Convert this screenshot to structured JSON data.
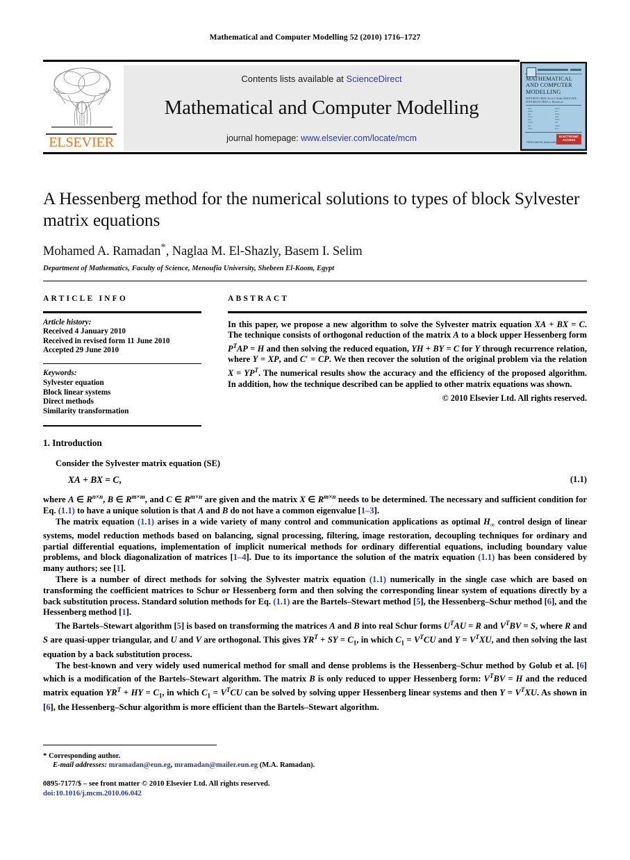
{
  "running_head": "Mathematical and Computer Modelling 52 (2010) 1716–1727",
  "masthead": {
    "contents_prefix": "Contents lists available at ",
    "sciencedirect": "ScienceDirect",
    "journal_name": "Mathematical and Computer Modelling",
    "homepage_prefix": "journal homepage: ",
    "homepage_url": "www.elsevier.com/locate/mcm",
    "publisher_wordmark": "ELSEVIER",
    "link_color": "#2B3B9E",
    "wordmark_color": "#E87722",
    "band_color": "#EAEAEA"
  },
  "cover": {
    "title": "MATHEMATICAL AND COMPUTER MODELLING",
    "editors": "EDITOR-IN-CHIEF: Ervin Y. Rodin\nASSOCIATE EDITORS-IN-CHIEF: C. Rhoades Jr.",
    "access_badge": "ELECTRONIC ACCESS",
    "publisher": "PERGAMON\nScienceDirect",
    "background_color": "#A8CCE4"
  },
  "article": {
    "title": "A Hessenberg method for the numerical solutions to types of block Sylvester matrix equations",
    "authors": "Mohamed A. Ramadan",
    "authors_rest": ", Naglaa M. El-Shazly, Basem I. Selim",
    "corresponding_marker": "*",
    "affiliation": "Department of Mathematics, Faculty of Science, Menoufia University, Shebeen El-Koom, Egypt"
  },
  "info": {
    "heading": "ARTICLE INFO",
    "history_label": "Article history:",
    "history": [
      "Received 4 January 2010",
      "Received in revised form 11 June 2010",
      "Accepted 29 June 2010"
    ],
    "keywords_label": "Keywords:",
    "keywords": [
      "Sylvester equation",
      "Block linear systems",
      "Direct methods",
      "Similarity transformation"
    ]
  },
  "abstract": {
    "heading": "ABSTRACT",
    "text": "In this paper, we propose a new algorithm to solve the Sylvester matrix equation XA + BX = C. The technique consists of orthogonal reduction of the matrix A to a block upper Hessenberg form PTAP = H and then solving the reduced equation, YH + BY = C for Y through recurrence relation, where Y = XP, and C′ = CP. We then recover the solution of the original problem via the relation X = YPT. The numerical results show the accuracy and the efficiency of the proposed algorithm. In addition, how the technique described can be applied to other matrix equations was shown.",
    "copyright": "© 2010 Elsevier Ltd. All rights reserved."
  },
  "body": {
    "section_number": "1.",
    "section_title": "Introduction",
    "p_consider": "Consider the Sylvester matrix equation (SE)",
    "equation_1_1": "XA + BX = C,",
    "equation_1_1_number": "(1.1)",
    "p2_pre": "where A ∈ R",
    "p3": "The matrix equation (1.1) arises in a wide variety of many control and communication applications as optimal H∞ control design of linear systems, model reduction methods based on balancing, signal processing, filtering, image restoration, decoupling techniques for ordinary and partial differential equations, implementation of implicit numerical methods for ordinary differential equations, including boundary value problems, and block diagonalization of matrices [1–4]. Due to its importance the solution of the matrix equation (1.1) has been considered by many authors; see [1].",
    "p4": "There is a number of direct methods for solving the Sylvester matrix equation (1.1) numerically in the single case which are based on transforming the coefficient matrices to Schur or Hessenberg form and then solving the corresponding linear system of equations directly by a back substitution process. Standard solution methods for Eq. (1.1) are the Bartels–Stewart method [5], the Hessenberg–Schur method [6], and the Hessenberg method [1].",
    "p5": "The Bartels–Stewart algorithm [5] is based on transforming the matrices A and B into real Schur forms UTAU = R and VTBV = S, where R and S are quasi-upper triangular, and U and V are orthogonal. This gives YRT + SY = C1, in which C1 = VTCU and Y = VTXU, and then solving the last equation by a back substitution process.",
    "p6": "The best-known and very widely used numerical method for small and dense problems is the Hessenberg–Schur method by Golub et al. [6] which is a modification of the Bartels–Stewart algorithm. The matrix B is only reduced to upper Hessenberg form: VTBV = H and the reduced matrix equation YRT + HY = C1, in which C1 = VTCU can be solved by solving upper Hessenberg linear systems and then Y = VTXU. As shown in [6], the Hessenberg–Schur algorithm is more efficient than the Bartels–Stewart algorithm."
  },
  "footnote": {
    "star": "*",
    "corresponding": "Corresponding author.",
    "email_label": "E-mail addresses:",
    "email_1": "mramadan@eun.eg",
    "email_2": "mramadan@mailer.eun.eg",
    "email_owner": "(M.A. Ramadan)."
  },
  "footer": {
    "issn_line": "0895-7177/$ – see front matter © 2010 Elsevier Ltd. All rights reserved.",
    "doi": "doi:10.1016/j.mcm.2010.06.042"
  }
}
